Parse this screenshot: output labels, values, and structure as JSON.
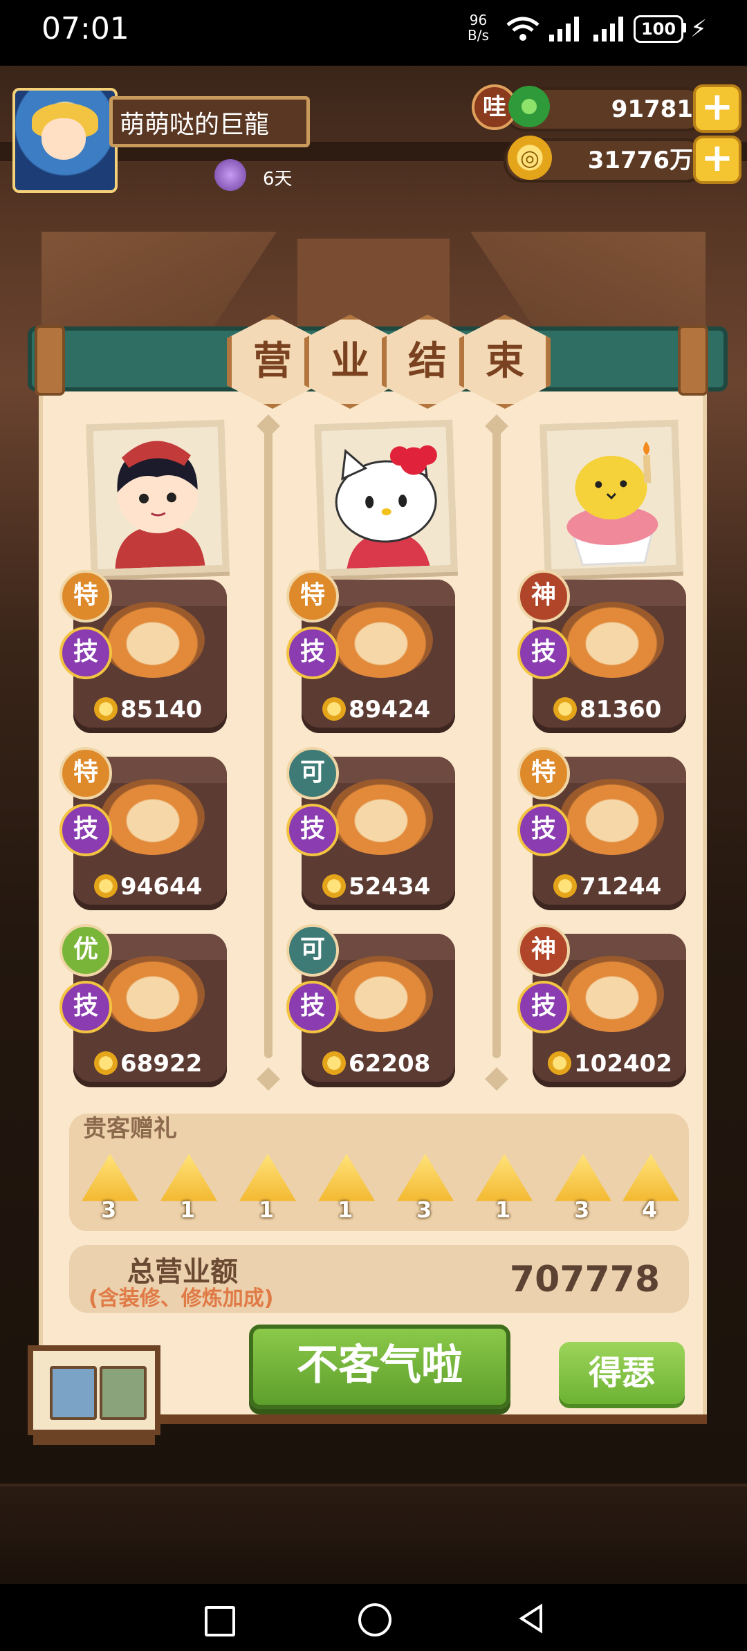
{
  "status_bar": {
    "time": "07:01",
    "net_speed_value": "96",
    "net_speed_unit": "B/s",
    "battery": "100"
  },
  "player": {
    "name": "萌萌哒的巨龍",
    "days": "6天"
  },
  "currencies": {
    "jade_badge": "哇",
    "jade_amount": "91781",
    "coin_amount": "31776万"
  },
  "banner": {
    "chars": [
      "营",
      "业",
      "结",
      "束"
    ]
  },
  "guests": [
    {
      "name": "chef-boy",
      "dishes": [
        {
          "grade": "特",
          "grade_color": "#de8a2a",
          "skill": "技",
          "price": "85140"
        },
        {
          "grade": "特",
          "grade_color": "#de8a2a",
          "skill": "技",
          "price": "94644"
        },
        {
          "grade": "优",
          "grade_color": "#79b539",
          "skill": "技",
          "price": "68922"
        }
      ]
    },
    {
      "name": "hello-kitty",
      "dishes": [
        {
          "grade": "特",
          "grade_color": "#de8a2a",
          "skill": "技",
          "price": "89424"
        },
        {
          "grade": "可",
          "grade_color": "#3e7a76",
          "skill": "技",
          "price": "52434"
        },
        {
          "grade": "可",
          "grade_color": "#3e7a76",
          "skill": "技",
          "price": "62208"
        }
      ]
    },
    {
      "name": "cupcake-chick",
      "dishes": [
        {
          "grade": "神",
          "grade_color": "#b0452a",
          "skill": "技",
          "price": "81360"
        },
        {
          "grade": "特",
          "grade_color": "#de8a2a",
          "skill": "技",
          "price": "71244"
        },
        {
          "grade": "神",
          "grade_color": "#b0452a",
          "skill": "技",
          "price": "102402"
        }
      ]
    }
  ],
  "gifts": {
    "title": "贵客赠礼",
    "items": [
      "3",
      "1",
      "1",
      "1",
      "3",
      "1",
      "3",
      "4"
    ]
  },
  "total": {
    "label": "总营业额",
    "sub": "(含装修、修炼加成)",
    "value": "707778"
  },
  "buttons": {
    "main": "不客气啦",
    "side": "得瑟"
  },
  "colors": {
    "panel": "#fbe8cc",
    "banner": "#2f6e63",
    "button_green": "#6db233"
  }
}
